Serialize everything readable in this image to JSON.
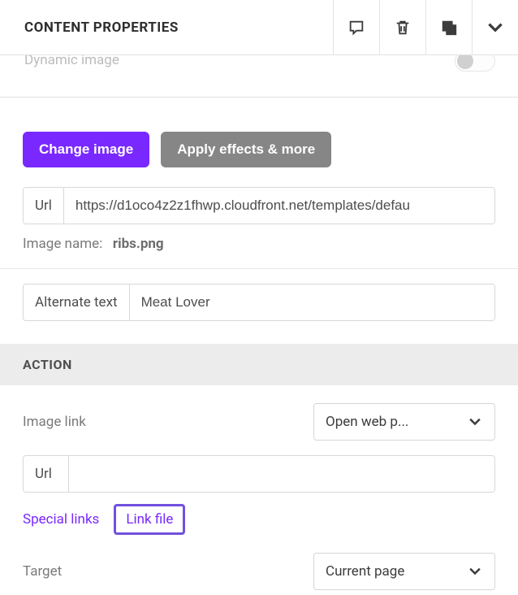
{
  "header": {
    "title": "CONTENT PROPERTIES"
  },
  "dynamic_image": {
    "label": "Dynamic image"
  },
  "image": {
    "change_btn": "Change image",
    "effects_btn": "Apply effects & more",
    "url_label": "Url",
    "url_value": "https://d1oco4z2z1fhwp.cloudfront.net/templates/defau",
    "name_label": "Image name:",
    "name_value": "ribs.png"
  },
  "alt": {
    "label": "Alternate text",
    "value": "Meat Lover"
  },
  "action": {
    "title": "ACTION",
    "image_link_label": "Image link",
    "image_link_value": "Open web p...",
    "url_label": "Url",
    "url_value": "",
    "special_links": "Special links",
    "link_file": "Link file",
    "target_label": "Target",
    "target_value": "Current page"
  }
}
